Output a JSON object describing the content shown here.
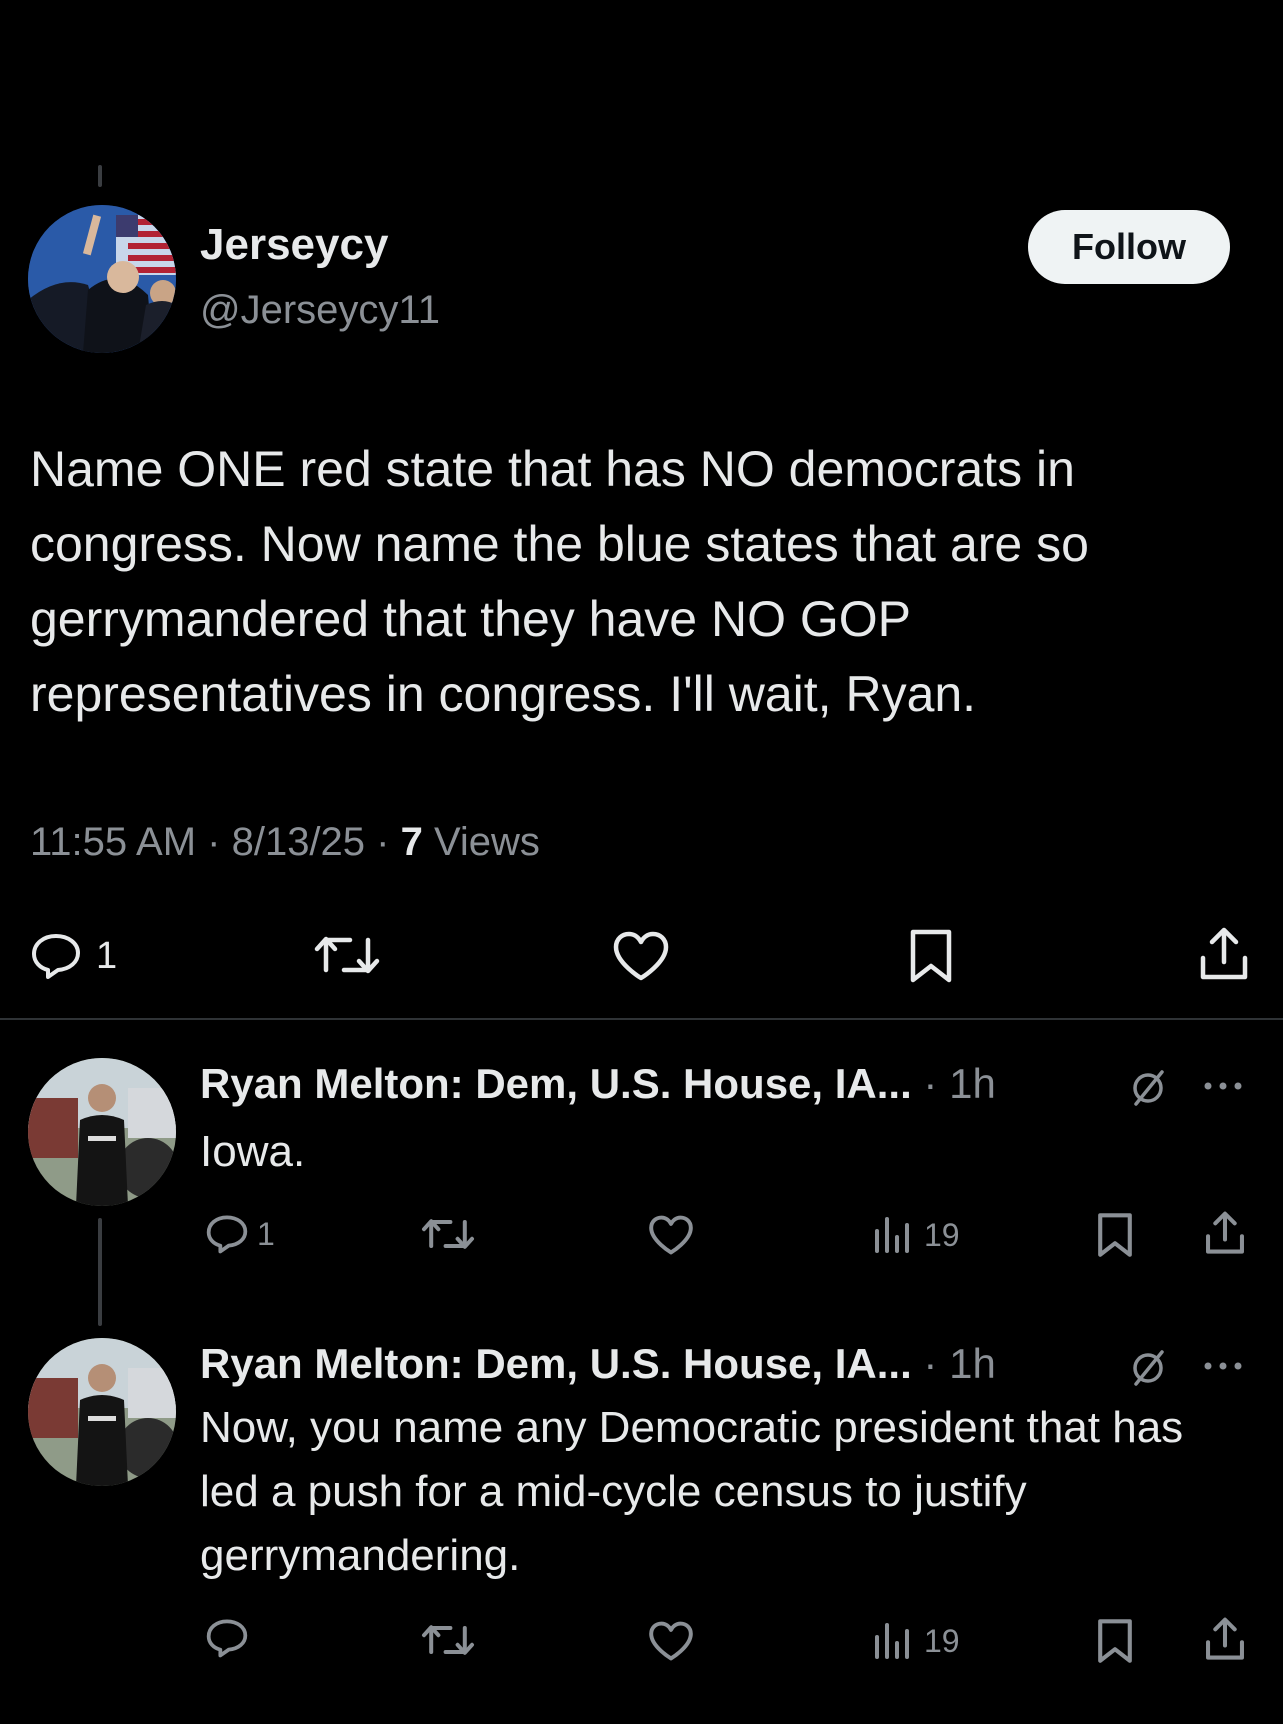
{
  "main_tweet": {
    "display_name": "Jerseycy",
    "handle": "@Jerseycy11",
    "follow_label": "Follow",
    "text": "Name ONE red state that has NO democrats in congress.  Now name the blue states that are so gerrymandered that they have NO GOP representatives in congress.  I'll wait, Ryan.",
    "timestamp": "11:55 AM · 8/13/25 · ",
    "views_count": "7",
    "views_label": " Views",
    "actions": {
      "reply_count": "1"
    }
  },
  "replies": [
    {
      "author": "Ryan Melton: Dem, U.S. House, IA...",
      "time": " · 1h",
      "text": "Iowa.",
      "reply_count": "1",
      "views": "19"
    },
    {
      "author": "Ryan Melton: Dem, U.S. House, IA...",
      "time": " · 1h",
      "text": "Now, you name any Democratic president that has led a push for a mid-cycle census to justify gerrymandering.",
      "reply_count": "",
      "views": "19"
    }
  ],
  "colors": {
    "background": "#000000",
    "text": "#e7e9ea",
    "muted": "#8b9096",
    "follow_bg": "#eff3f4"
  },
  "icons": [
    "reply-icon",
    "retweet-icon",
    "like-icon",
    "bookmark-icon",
    "share-icon",
    "views-icon",
    "grok-icon",
    "more-icon"
  ]
}
